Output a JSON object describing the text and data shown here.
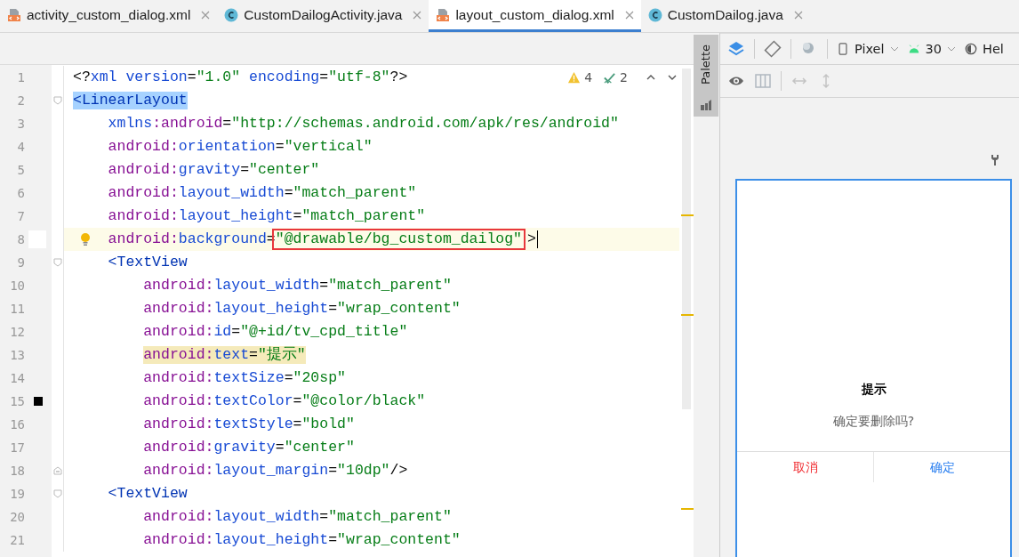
{
  "tabs": [
    {
      "label": "activity_custom_dialog.xml",
      "kind": "xml",
      "selected": false
    },
    {
      "label": "CustomDailogActivity.java",
      "kind": "java",
      "selected": false
    },
    {
      "label": "layout_custom_dialog.xml",
      "kind": "xml",
      "selected": true
    },
    {
      "label": "CustomDailog.java",
      "kind": "java",
      "selected": false
    }
  ],
  "editor": {
    "inspections": {
      "warnings": "4",
      "checks": "2"
    },
    "lines": [
      {
        "number": "1",
        "current": false,
        "kind": "plain",
        "tokens": [
          {
            "kind": "punct",
            "text": "<?"
          },
          {
            "kind": "attr",
            "text": "xml version"
          },
          {
            "kind": "punct",
            "text": "="
          },
          {
            "kind": "value",
            "text": "\"1.0\""
          },
          {
            "kind": "attr",
            "text": " encoding"
          },
          {
            "kind": "punct",
            "text": "="
          },
          {
            "kind": "value",
            "text": "\"utf-8\""
          },
          {
            "kind": "punct",
            "text": "?>"
          }
        ]
      },
      {
        "number": "2",
        "current": false,
        "kind": "fold-start",
        "tokens": [
          {
            "kind": "tag",
            "text": "<LinearLayout",
            "selected": true
          }
        ]
      },
      {
        "number": "3",
        "current": false,
        "kind": "plain",
        "tokens": [
          {
            "kind": "attr",
            "text": "    xmlns"
          },
          {
            "kind": "ns",
            "text": ":android"
          },
          {
            "kind": "punct",
            "text": "="
          },
          {
            "kind": "value",
            "text": "\"http://schemas.android.com/apk/res/android\""
          }
        ]
      },
      {
        "number": "4",
        "current": false,
        "kind": "plain",
        "tokens": [
          {
            "kind": "ns",
            "text": "    android:"
          },
          {
            "kind": "attr",
            "text": "orientation"
          },
          {
            "kind": "punct",
            "text": "="
          },
          {
            "kind": "value",
            "text": "\"vertical\""
          }
        ]
      },
      {
        "number": "5",
        "current": false,
        "kind": "plain",
        "tokens": [
          {
            "kind": "ns",
            "text": "    android:"
          },
          {
            "kind": "attr",
            "text": "gravity"
          },
          {
            "kind": "punct",
            "text": "="
          },
          {
            "kind": "value",
            "text": "\"center\""
          }
        ]
      },
      {
        "number": "6",
        "current": false,
        "kind": "plain",
        "tokens": [
          {
            "kind": "ns",
            "text": "    android:"
          },
          {
            "kind": "attr",
            "text": "layout_width"
          },
          {
            "kind": "punct",
            "text": "="
          },
          {
            "kind": "value",
            "text": "\"match_parent\""
          }
        ]
      },
      {
        "number": "7",
        "current": false,
        "kind": "plain",
        "tokens": [
          {
            "kind": "ns",
            "text": "    android:"
          },
          {
            "kind": "attr",
            "text": "layout_height"
          },
          {
            "kind": "punct",
            "text": "="
          },
          {
            "kind": "value",
            "text": "\"match_parent\""
          }
        ]
      },
      {
        "number": "8",
        "current": true,
        "kind": "bulb",
        "tokens": [
          {
            "kind": "ns",
            "text": "    android:"
          },
          {
            "kind": "attr",
            "text": "background"
          },
          {
            "kind": "punct",
            "text": "="
          },
          {
            "kind": "value",
            "text": "\"@drawable/bg_custom_dailog\"",
            "boxed": true
          },
          {
            "kind": "punct",
            "text": ">"
          }
        ]
      },
      {
        "number": "9",
        "current": false,
        "kind": "fold-start",
        "tokens": [
          {
            "kind": "tag",
            "text": "    <TextView"
          }
        ]
      },
      {
        "number": "10",
        "current": false,
        "kind": "plain",
        "tokens": [
          {
            "kind": "ns",
            "text": "        android:"
          },
          {
            "kind": "attr",
            "text": "layout_width"
          },
          {
            "kind": "punct",
            "text": "="
          },
          {
            "kind": "value",
            "text": "\"match_parent\""
          }
        ]
      },
      {
        "number": "11",
        "current": false,
        "kind": "plain",
        "tokens": [
          {
            "kind": "ns",
            "text": "        android:"
          },
          {
            "kind": "attr",
            "text": "layout_height"
          },
          {
            "kind": "punct",
            "text": "="
          },
          {
            "kind": "value",
            "text": "\"wrap_content\""
          }
        ]
      },
      {
        "number": "12",
        "current": false,
        "kind": "plain",
        "tokens": [
          {
            "kind": "ns",
            "text": "        android:"
          },
          {
            "kind": "attr",
            "text": "id"
          },
          {
            "kind": "punct",
            "text": "="
          },
          {
            "kind": "value",
            "text": "\"@+id/tv_cpd_title\""
          }
        ]
      },
      {
        "number": "13",
        "current": false,
        "kind": "plain",
        "tokens": [
          {
            "kind": "ns",
            "text": "        android:",
            "highlighted": true
          },
          {
            "kind": "attr",
            "text": "text",
            "highlighted": true
          },
          {
            "kind": "punct",
            "text": "=",
            "highlighted": true
          },
          {
            "kind": "value",
            "text": "\"提示\"",
            "highlighted": true
          }
        ]
      },
      {
        "number": "14",
        "current": false,
        "kind": "plain",
        "tokens": [
          {
            "kind": "ns",
            "text": "        android:"
          },
          {
            "kind": "attr",
            "text": "textSize"
          },
          {
            "kind": "punct",
            "text": "="
          },
          {
            "kind": "value",
            "text": "\"20sp\""
          }
        ]
      },
      {
        "number": "15",
        "current": false,
        "kind": "swatch",
        "tokens": [
          {
            "kind": "ns",
            "text": "        android:"
          },
          {
            "kind": "attr",
            "text": "textColor"
          },
          {
            "kind": "punct",
            "text": "="
          },
          {
            "kind": "value",
            "text": "\"@color/black\""
          }
        ]
      },
      {
        "number": "16",
        "current": false,
        "kind": "plain",
        "tokens": [
          {
            "kind": "ns",
            "text": "        android:"
          },
          {
            "kind": "attr",
            "text": "textStyle"
          },
          {
            "kind": "punct",
            "text": "="
          },
          {
            "kind": "value",
            "text": "\"bold\""
          }
        ]
      },
      {
        "number": "17",
        "current": false,
        "kind": "plain",
        "tokens": [
          {
            "kind": "ns",
            "text": "        android:"
          },
          {
            "kind": "attr",
            "text": "gravity"
          },
          {
            "kind": "punct",
            "text": "="
          },
          {
            "kind": "value",
            "text": "\"center\""
          }
        ]
      },
      {
        "number": "18",
        "current": false,
        "kind": "fold-end",
        "tokens": [
          {
            "kind": "ns",
            "text": "        android:"
          },
          {
            "kind": "attr",
            "text": "layout_margin"
          },
          {
            "kind": "punct",
            "text": "="
          },
          {
            "kind": "value",
            "text": "\"10dp\""
          },
          {
            "kind": "punct",
            "text": "/>"
          }
        ]
      },
      {
        "number": "19",
        "current": false,
        "kind": "fold-start",
        "tokens": [
          {
            "kind": "tag",
            "text": "    <TextView"
          }
        ]
      },
      {
        "number": "20",
        "current": false,
        "kind": "plain",
        "tokens": [
          {
            "kind": "ns",
            "text": "        android:"
          },
          {
            "kind": "attr",
            "text": "layout_width"
          },
          {
            "kind": "punct",
            "text": "="
          },
          {
            "kind": "value",
            "text": "\"match_parent\""
          }
        ]
      },
      {
        "number": "21",
        "current": false,
        "kind": "plain",
        "tokens": [
          {
            "kind": "ns",
            "text": "        android:"
          },
          {
            "kind": "attr",
            "text": "layout_height"
          },
          {
            "kind": "punct",
            "text": "="
          },
          {
            "kind": "value",
            "text": "\"wrap_content\""
          }
        ]
      }
    ]
  },
  "palette": {
    "label": "Palette"
  },
  "preview": {
    "device": "Pixel",
    "api": "30",
    "theme": "Hel",
    "dialog": {
      "title": "提示",
      "message": "确定要删除吗?",
      "buttons": [
        {
          "label": "取消",
          "color": "#f0282d"
        },
        {
          "label": "确定",
          "color": "#2a7ff0"
        }
      ]
    }
  }
}
